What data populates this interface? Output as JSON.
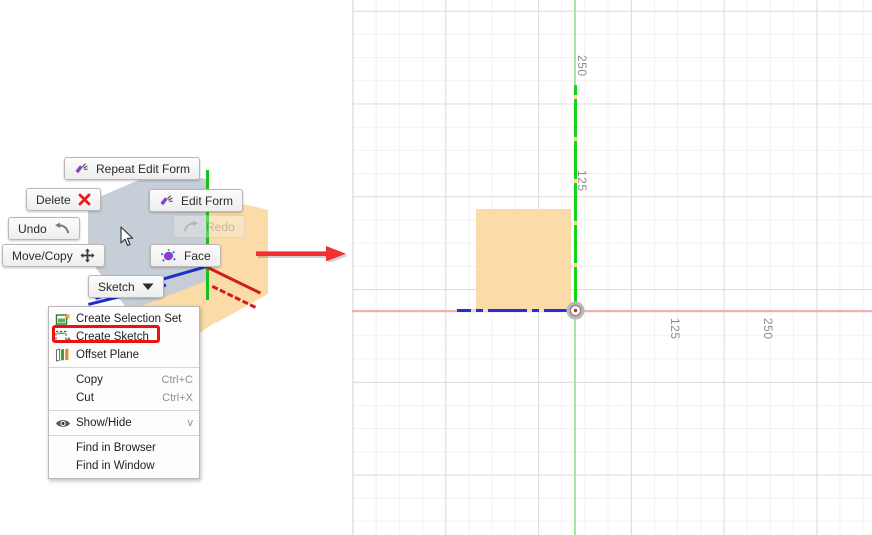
{
  "app": {
    "view_left_name": "3d-model-marking-menu-view",
    "view_right_name": "sketch-grid-view"
  },
  "marking_menu": {
    "buttons": [
      {
        "id": "repeat-edit-form",
        "label": "Repeat Edit Form",
        "icon": "repeat-edit-form-icon",
        "enabled": true
      },
      {
        "id": "delete",
        "label": "Delete",
        "icon": "delete-x-icon",
        "enabled": true
      },
      {
        "id": "edit-form",
        "label": "Edit Form",
        "icon": "edit-form-icon",
        "enabled": true
      },
      {
        "id": "undo",
        "label": "Undo",
        "icon": "undo-arrow-icon",
        "enabled": true
      },
      {
        "id": "redo",
        "label": "Redo",
        "icon": "redo-arrow-icon",
        "enabled": false
      },
      {
        "id": "move-copy",
        "label": "Move/Copy",
        "icon": "move-copy-icon",
        "enabled": true
      },
      {
        "id": "face",
        "label": "Face",
        "icon": "face-icon",
        "enabled": true
      },
      {
        "id": "sketch",
        "label": "Sketch",
        "icon": "chevron-down-icon",
        "enabled": true
      }
    ]
  },
  "context_menu": {
    "items": [
      {
        "label": "Create Selection Set",
        "shortcut": "",
        "icon": "create-selection-set-icon",
        "highlighted": false
      },
      {
        "label": "Create Sketch",
        "shortcut": "",
        "icon": "create-sketch-icon",
        "highlighted": true
      },
      {
        "label": "Offset Plane",
        "shortcut": "",
        "icon": "offset-plane-icon",
        "highlighted": false
      },
      {
        "label": "Copy",
        "shortcut": "Ctrl+C",
        "icon": "",
        "highlighted": false
      },
      {
        "label": "Cut",
        "shortcut": "Ctrl+X",
        "icon": "",
        "highlighted": false
      },
      {
        "label": "Show/Hide",
        "shortcut": "v",
        "icon": "eye-icon",
        "highlighted": false
      },
      {
        "label": "Find in Browser",
        "shortcut": "",
        "icon": "",
        "highlighted": false
      },
      {
        "label": "Find in Window",
        "shortcut": "",
        "icon": "",
        "highlighted": false
      }
    ],
    "highlight_color": "#ee1111"
  },
  "annotation": {
    "arrow_name": "red-pointer-arrow",
    "arrow_color": "#f23030",
    "direction": "right"
  },
  "sketch_view": {
    "axis_labels": {
      "y_upper": "250",
      "y_lower": "125",
      "x_inner": "125",
      "x_outer": "250"
    },
    "colors": {
      "x_axis": "#f2afaf",
      "y_axis": "#a8e6a8",
      "y_axis_active": "#15d415",
      "profile_fill": "#fbdca8",
      "profile_edge": "#2a2ae0",
      "grid_minor": "#f1f1f1",
      "grid_major": "#dcdcdc"
    },
    "elements": {
      "origin": "origin-marker",
      "rectangle": "sketch-rectangle",
      "constraint_line": "blue-dash-dot-line"
    }
  }
}
